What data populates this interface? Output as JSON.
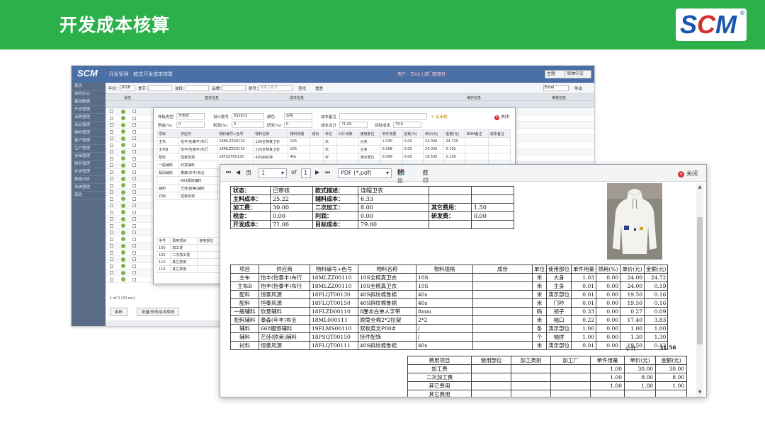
{
  "slide": {
    "title": "开发成本核算",
    "logo_text": "SCM",
    "logo_mark": "®"
  },
  "app": {
    "logo": "SCM",
    "breadcrumb": "· 开发管理 · 款式开发成本核算",
    "status": "用户：王XX  |  部门管理员",
    "top_select_1": "主题",
    "top_select_2": "简体中文",
    "side_items": [
      "首页",
      "协同办公",
      "基础数据",
      "开发管理",
      "采购管理",
      "商品管理",
      "物料管理",
      "客户管理",
      "生产管理",
      "仓储管理",
      "财务管理",
      "外协管理",
      "数据分析",
      "系统管理",
      "其他"
    ],
    "filters": {
      "year_label": "年份：",
      "year_value": "2018",
      "season_label": "季节：",
      "band_label": "波段：",
      "brand_label": "品牌：",
      "style_label": "款号：",
      "style_placeholder": "请录入款号",
      "search": "查找",
      "reset": "重置",
      "export_sel": "Excel",
      "export": "导出"
    },
    "grid_headers": {
      "status": "状态",
      "base": "基本信息",
      "cost": "成本信息",
      "maint": "维护信息",
      "audit": "审核信息"
    },
    "pager": "1 of 2 (20 rec)",
    "btn_audit": "审核",
    "btn_batch": "批量/修改成本明细"
  },
  "dialog": {
    "fields": {
      "style_type_lbl": "样板类型",
      "style_type_val": "开色样",
      "design_no_lbl": "设计款号",
      "design_no_val": "832913",
      "color_lbl": "颜色",
      "color_val": "白色",
      "cost_note_lbl": "成本备注",
      "recheck_btn": "反审核",
      "close": "关闭",
      "tax_lbl": "税金(%)",
      "tax_val": "0",
      "profit_lbl": "利润(%)",
      "profit_val": "0",
      "rd_lbl": "研发(%)",
      "rd_val": "0",
      "cost_total_lbl": "成本合计",
      "cost_total_val": "71.06",
      "target_lbl": "目标成本",
      "target_val": "79.6"
    },
    "headers": [
      "项目",
      "供应商",
      "物料编号+色号",
      "物料名称",
      "物料规格",
      "成份",
      "单位",
      "公斤米数",
      "使用部位",
      "单件用量",
      "损耗(%)",
      "单价(元)",
      "金额(元)",
      "BOM备注",
      "成本备注"
    ],
    "rows": [
      [
        "主布",
        "怡丰(怡泰丰)布行",
        "18MLZZ00110",
        "10S全棉真卫衣",
        "10S",
        "",
        "米",
        "",
        "大身",
        "1.030",
        "0.00",
        "24.000",
        "24.720"
      ],
      [
        "主布B",
        "怡丰(怡泰丰)布行",
        "18MLZZ00110",
        "10S全棉真卫衣",
        "10S",
        "",
        "米",
        "",
        "主身",
        "0.008",
        "0.00",
        "24.000",
        "0.192"
      ],
      [
        "配料",
        "恒泰风源",
        "18FLQT00130",
        "40S斜纹棉",
        "40s",
        "",
        "米",
        "",
        "演示部位",
        "0.008",
        "0.00",
        "19.500",
        "0.156"
      ],
      [
        "一般辅料",
        "欣意辅料",
        "",
        "",
        "",
        "",
        "",
        "",
        "",
        "",
        "",
        "",
        ""
      ],
      [
        "配码辅料",
        "泰森(年丰)布业",
        "18ML000",
        "",
        "",
        "",
        "",
        "",
        "",
        "",
        "",
        "",
        ""
      ],
      [
        "",
        "668服饰辅料",
        "",
        "",
        "",
        "",
        "",
        "",
        "",
        "",
        "",
        "",
        ""
      ],
      [
        "辅料",
        "艺佳(欧美)辅料",
        "18PLMS",
        "",
        "",
        "",
        "",
        "",
        "",
        "",
        "",
        "",
        ""
      ],
      [
        "衬料",
        "恒泰风源",
        "18FLQT",
        "",
        "",
        "",
        "",
        "",
        "",
        "",
        "",
        "",
        ""
      ]
    ],
    "fee_headers": [
      "序号",
      "费用项目",
      "使用部位"
    ],
    "fee_rows": [
      [
        "100",
        "加工费"
      ],
      [
        "105",
        "二次加工费"
      ],
      [
        "110",
        "其它费用"
      ],
      [
        "115",
        "其它费用"
      ]
    ]
  },
  "toolbar": {
    "page_label": "页",
    "page_value": "1",
    "of_label": "of",
    "of_value": "1",
    "format": "PDF (*.pdf)",
    "export": "导出",
    "print": "打印",
    "close": "关闭"
  },
  "report": {
    "header": [
      [
        "状态：",
        "已审核",
        "款式描述：",
        "连帽卫衣",
        "",
        ""
      ],
      [
        "主料成本：",
        "25.22",
        "辅料成本：",
        "6.33",
        "",
        ""
      ],
      [
        "加工费：",
        "30.00",
        "二次加工：",
        "8.00",
        "其它费用：",
        "1.50"
      ],
      [
        "税金：",
        "0.00",
        "利润：",
        "0.00",
        "研发费：",
        "0.00"
      ],
      [
        "开发成本：",
        "71.06",
        "目标成本：",
        "79.60",
        "",
        ""
      ]
    ],
    "material_headers": [
      "项目",
      "供应商",
      "物料编号+色号",
      "物料名称",
      "物料规格",
      "成份",
      "单位",
      "使用部位",
      "单件用量",
      "损耗(%)",
      "单价(元)",
      "金额(元)"
    ],
    "materials": [
      [
        "主布",
        "怡丰(怡泰丰)布行",
        "18MLZZ00110",
        "10S全棉真卫衣",
        "10S",
        "",
        "米",
        "大身",
        "1.03",
        "0.00",
        "24.00",
        "24.72"
      ],
      [
        "主布B",
        "怡丰(怡泰丰)布行",
        "18MLZZ00110",
        "10S全棉真卫衣",
        "10S",
        "",
        "米",
        "主身",
        "0.01",
        "0.00",
        "24.00",
        "0.19"
      ],
      [
        "配料",
        "恒泰风源",
        "18FLQT00130",
        "40S斜纹棉鲁棉",
        "40s",
        "",
        "米",
        "演示部位",
        "0.01",
        "0.00",
        "19.50",
        "0.16"
      ],
      [
        "配料",
        "恒泰风源",
        "18FLQT00150",
        "40S斜纹棉鲁棉",
        "40s",
        "",
        "米",
        "门衿",
        "0.01",
        "0.00",
        "19.50",
        "0.16"
      ],
      [
        "一般辅料",
        "欣意辅料",
        "18FLZD00110",
        "8厘本白单人字带",
        "8mm",
        "",
        "码",
        "领子",
        "0.33",
        "0.00",
        "0.27",
        "0.09"
      ],
      [
        "配码辅料",
        "泰森(年丰)布业",
        "18ML000111",
        "原筒全棉2*2拉架",
        "2*2",
        "",
        "米",
        "袖口",
        "0.22",
        "0.00",
        "17.40",
        "3.83"
      ],
      [
        "辅料",
        "668服饰辅料",
        "19FLMS00110",
        "双枚英文P00#",
        "/",
        "",
        "条",
        "演示部位",
        "1.00",
        "0.00",
        "1.00",
        "1.00"
      ],
      [
        "辅料",
        "艺佳(欧美)辅料",
        "18PSQT00150",
        "挂件配饰",
        "/",
        "",
        "个",
        "袖拼",
        "1.00",
        "0.00",
        "1.30",
        "1.30"
      ],
      [
        "衬料",
        "恒泰风源",
        "18FLQT00111",
        "40S斜纹棉鲁棉",
        "40s",
        "",
        "米",
        "演示部位",
        "0.01",
        "0.00",
        "19.50",
        "0.12"
      ]
    ],
    "subtotal_label": "小计：",
    "subtotal_value": "31.56",
    "fee_headers": [
      "费用项目",
      "使用部位",
      "加工类别",
      "加工厂",
      "单件用量",
      "单价(元)",
      "金额(元)"
    ],
    "fees": [
      [
        "加工费",
        "",
        "",
        "",
        "1.00",
        "30.00",
        "30.00"
      ],
      [
        "二次加工费",
        "",
        "",
        "",
        "1.00",
        "8.00",
        "8.00"
      ],
      [
        "其它费用",
        "",
        "",
        "",
        "1.00",
        "1.00",
        "1.00"
      ],
      [
        "其它费用",
        "",
        "",
        "",
        "",
        "",
        ""
      ]
    ]
  },
  "colors": {
    "banner": "#2cb04a",
    "app_header": "#4a6fa5",
    "close_red": "#d32f2f"
  }
}
